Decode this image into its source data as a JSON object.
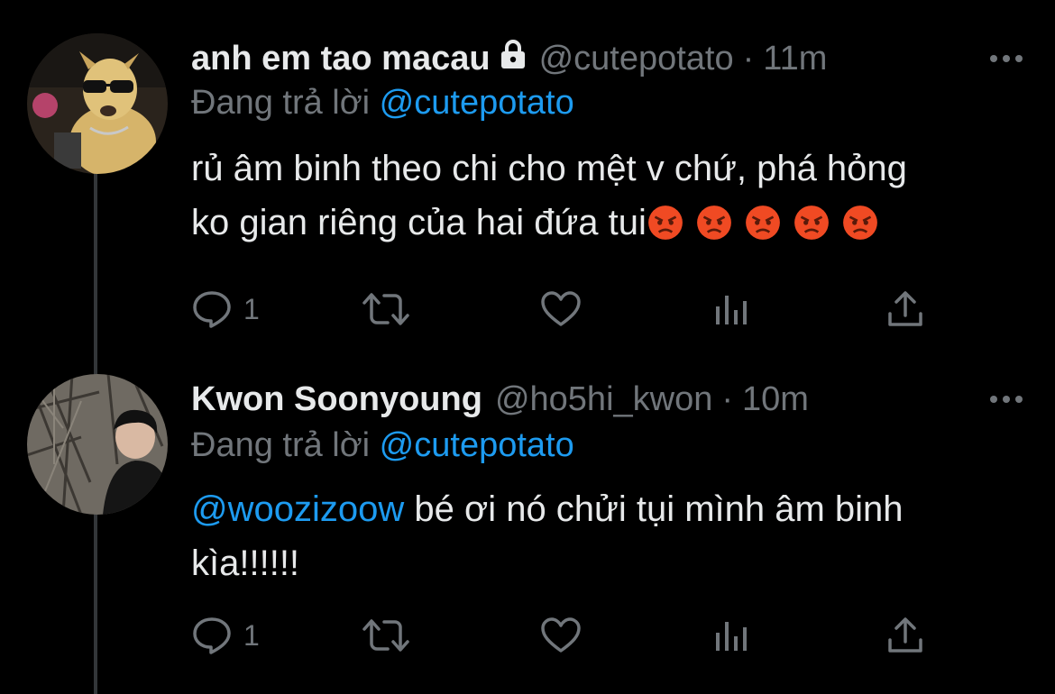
{
  "tweets": [
    {
      "display_name": "anh em tao macau",
      "protected": true,
      "handle": "@cutepotato",
      "separator": "·",
      "time": "11m",
      "reply_prefix": "Đang trả lời",
      "reply_to": "@cutepotato",
      "text_line1": "rủ âm binh theo chi cho mệt v chứ, phá hỏng",
      "text_line2": "ko gian riêng của hai đứa tui",
      "emoji_count": 5,
      "reply_count": "1",
      "avatar_icon": "dog-sunglasses-avatar"
    },
    {
      "display_name": "Kwon Soonyoung",
      "protected": false,
      "handle": "@ho5hi_kwon",
      "separator": "·",
      "time": "10m",
      "reply_prefix": "Đang trả lời",
      "reply_to": "@cutepotato",
      "text_mention": "@woozizoow",
      "text_line1": " bé ơi nó chửi tụi mình âm binh",
      "text_line2": "kìa!!!!!!",
      "reply_count": "1",
      "avatar_icon": "person-outdoors-avatar"
    }
  ],
  "icons": {
    "reply": "speech-bubble-icon",
    "retweet": "retweet-icon",
    "like": "heart-icon",
    "analytics": "bar-chart-icon",
    "share": "share-upload-icon",
    "more": "more-dots-icon",
    "lock": "lock-icon",
    "emoji": "angry-face-emoji"
  },
  "colors": {
    "background": "#000000",
    "text": "#e7e9ea",
    "secondary": "#71767b",
    "accent": "#1d9bf0",
    "thread_line": "#333639"
  }
}
